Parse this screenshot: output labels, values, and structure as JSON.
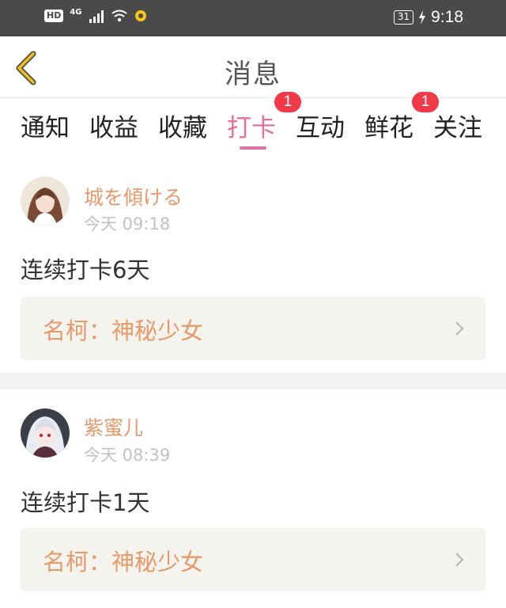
{
  "status_bar": {
    "hd": "HD",
    "network": "4G",
    "battery": "31",
    "time": "9:18",
    "icons": [
      "signal-icon",
      "wifi-icon",
      "notification-icon",
      "charging-icon"
    ]
  },
  "header": {
    "title": "消息",
    "back_icon": "back-chevron-icon"
  },
  "tabs": [
    {
      "label": "通知",
      "active": false
    },
    {
      "label": "收益",
      "active": false
    },
    {
      "label": "收藏",
      "active": false
    },
    {
      "label": "打卡",
      "active": true,
      "badge": "1"
    },
    {
      "label": "互动",
      "active": false
    },
    {
      "label": "鲜花",
      "active": false,
      "badge": "1"
    },
    {
      "label": "关注",
      "active": false
    }
  ],
  "messages": [
    {
      "user": "城を傾ける",
      "time": "今天 09:18",
      "text": "连续打卡6天",
      "link": "名柯：神秘少女"
    },
    {
      "user": "紫蜜儿",
      "time": "今天 08:39",
      "text": "连续打卡1天",
      "link": "名柯：神秘少女"
    }
  ],
  "colors": {
    "accent": "#e46ea4",
    "name": "#e69a6b",
    "badge": "#f03a4a",
    "back": "#f0c020"
  }
}
